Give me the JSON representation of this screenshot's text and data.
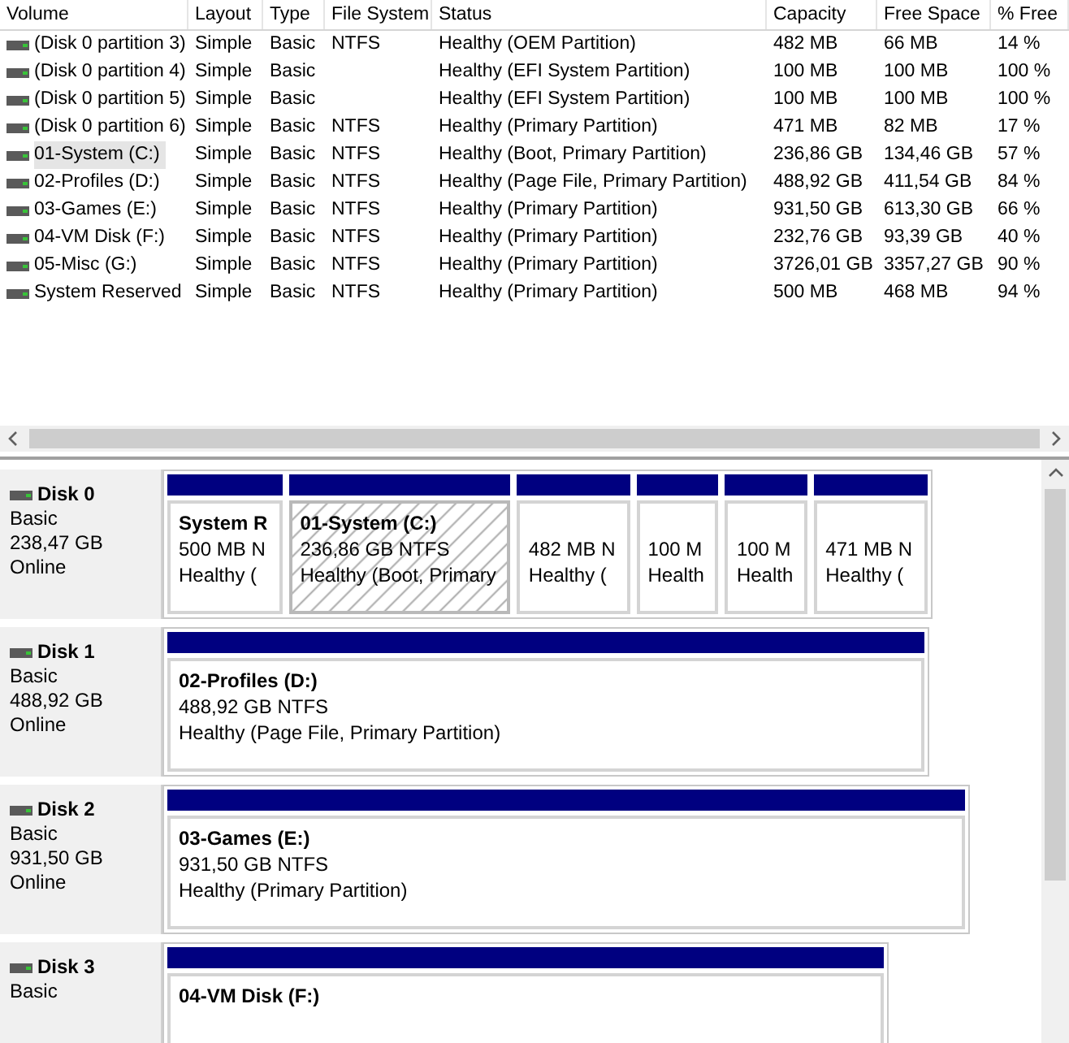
{
  "volumes": {
    "columns": [
      "Volume",
      "Layout",
      "Type",
      "File System",
      "Status",
      "Capacity",
      "Free Space",
      "% Free"
    ],
    "rows": [
      {
        "volume": "(Disk 0 partition 3)",
        "layout": "Simple",
        "type": "Basic",
        "file_system": "NTFS",
        "status": "Healthy (OEM Partition)",
        "capacity": "482 MB",
        "free_space": "66 MB",
        "percent_free": "14 %",
        "selected": false
      },
      {
        "volume": "(Disk 0 partition 4)",
        "layout": "Simple",
        "type": "Basic",
        "status": "Healthy (EFI System Partition)",
        "capacity": "100 MB",
        "free_space": "100 MB",
        "percent_free": "100 %",
        "selected": false
      },
      {
        "volume": "(Disk 0 partition 5)",
        "layout": "Simple",
        "type": "Basic",
        "status": "Healthy (EFI System Partition)",
        "capacity": "100 MB",
        "free_space": "100 MB",
        "percent_free": "100 %",
        "selected": false
      },
      {
        "volume": "(Disk 0 partition 6)",
        "layout": "Simple",
        "type": "Basic",
        "file_system": "NTFS",
        "status": "Healthy (Primary Partition)",
        "capacity": "471 MB",
        "free_space": "82 MB",
        "percent_free": "17 %",
        "selected": false
      },
      {
        "volume": "01-System (C:)",
        "layout": "Simple",
        "type": "Basic",
        "file_system": "NTFS",
        "status": "Healthy (Boot, Primary Partition)",
        "capacity": "236,86 GB",
        "free_space": "134,46 GB",
        "percent_free": "57 %",
        "selected": true
      },
      {
        "volume": "02-Profiles (D:)",
        "layout": "Simple",
        "type": "Basic",
        "file_system": "NTFS",
        "status": "Healthy (Page File, Primary Partition)",
        "capacity": "488,92 GB",
        "free_space": "411,54 GB",
        "percent_free": "84 %",
        "selected": false
      },
      {
        "volume": "03-Games (E:)",
        "layout": "Simple",
        "type": "Basic",
        "file_system": "NTFS",
        "status": "Healthy (Primary Partition)",
        "capacity": "931,50 GB",
        "free_space": "613,30 GB",
        "percent_free": "66 %",
        "selected": false
      },
      {
        "volume": "04-VM Disk (F:)",
        "layout": "Simple",
        "type": "Basic",
        "file_system": "NTFS",
        "status": "Healthy (Primary Partition)",
        "capacity": "232,76 GB",
        "free_space": "93,39 GB",
        "percent_free": "40 %",
        "selected": false
      },
      {
        "volume": "05-Misc (G:)",
        "layout": "Simple",
        "type": "Basic",
        "file_system": "NTFS",
        "status": "Healthy (Primary Partition)",
        "capacity": "3726,01 GB",
        "free_space": "3357,27 GB",
        "percent_free": "90 %",
        "selected": false
      },
      {
        "volume": "System Reserved",
        "layout": "Simple",
        "type": "Basic",
        "file_system": "NTFS",
        "status": "Healthy (Primary Partition)",
        "capacity": "500 MB",
        "free_space": "468 MB",
        "percent_free": "94 %",
        "selected": false
      }
    ]
  },
  "disks": [
    {
      "name": "Disk 0",
      "type": "Basic",
      "size": "238,47 GB",
      "status": "Online",
      "partitions": [
        {
          "name": "System R",
          "size": "500 MB N",
          "status": "Healthy (",
          "selected": false
        },
        {
          "name": "01-System  (C:)",
          "size": "236,86 GB NTFS",
          "status": "Healthy (Boot, Primary",
          "selected": true
        },
        {
          "size": "482 MB N",
          "status": "Healthy (",
          "selected": false
        },
        {
          "size": "100 M",
          "status": "Health",
          "selected": false
        },
        {
          "size": "100 M",
          "status": "Health",
          "selected": false
        },
        {
          "size": "471 MB N",
          "status": "Healthy (",
          "selected": false
        }
      ]
    },
    {
      "name": "Disk 1",
      "type": "Basic",
      "size": "488,92 GB",
      "status": "Online",
      "partitions": [
        {
          "name": "02-Profiles  (D:)",
          "size": "488,92 GB NTFS",
          "status": "Healthy (Page File, Primary Partition)",
          "selected": false
        }
      ]
    },
    {
      "name": "Disk 2",
      "type": "Basic",
      "size": "931,50 GB",
      "status": "Online",
      "partitions": [
        {
          "name": "03-Games  (E:)",
          "size": "931,50 GB NTFS",
          "status": "Healthy (Primary Partition)",
          "selected": false
        }
      ]
    },
    {
      "name": "Disk 3",
      "type": "Basic",
      "partitions": [
        {
          "name": "04-VM Disk  (F:)",
          "selected": false
        }
      ]
    }
  ]
}
